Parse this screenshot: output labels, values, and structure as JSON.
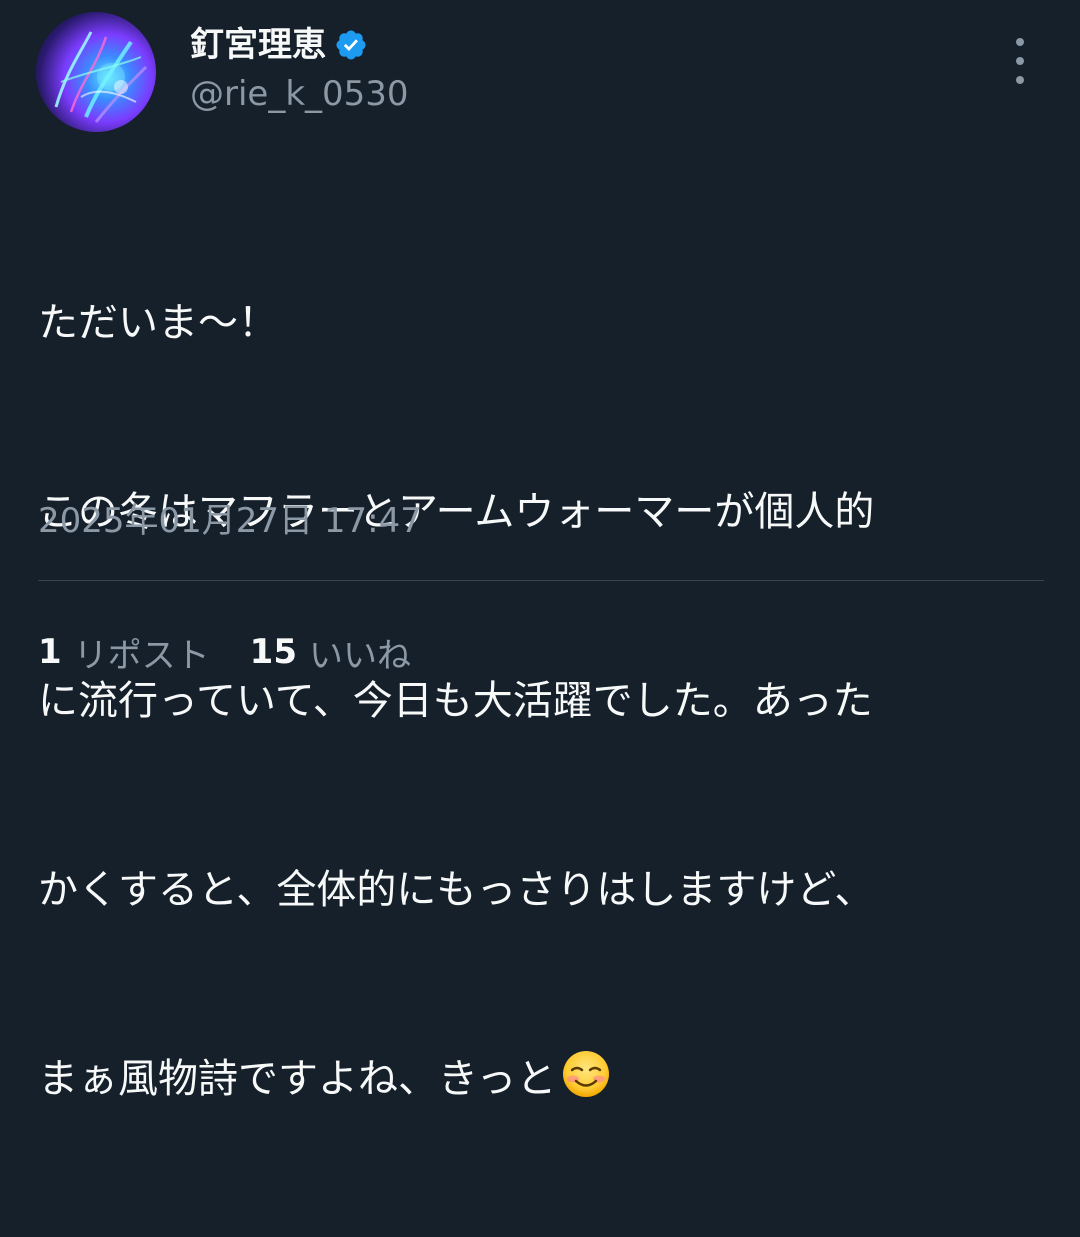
{
  "author": {
    "display_name": "釘宮理恵",
    "handle": "@rie_k_0530",
    "verified_icon": "verified-badge-icon",
    "avatar_icon": "abstract-neon-avatar"
  },
  "more_menu_icon": "more-vertical-icon",
  "tweet": {
    "lines": [
      "ただいま〜！",
      "この冬はマフラーとアームウォーマーが個人的",
      "に流行っていて、今日も大活躍でした。あった",
      "かくすると、全体的にもっさりはしますけど、",
      "まぁ風物詩ですよね、きっと"
    ],
    "trailing_emoji": "☺️",
    "timestamp": "2025年01月27日 17:47"
  },
  "stats": {
    "reposts_count": "1",
    "reposts_label": "リポスト",
    "likes_count": "15",
    "likes_label": "いいね"
  },
  "colors": {
    "background": "#15202b",
    "text": "#f7f9f9",
    "secondary_text": "#8b98a5",
    "divider": "#38444d",
    "verified": "#1d9bf0"
  }
}
